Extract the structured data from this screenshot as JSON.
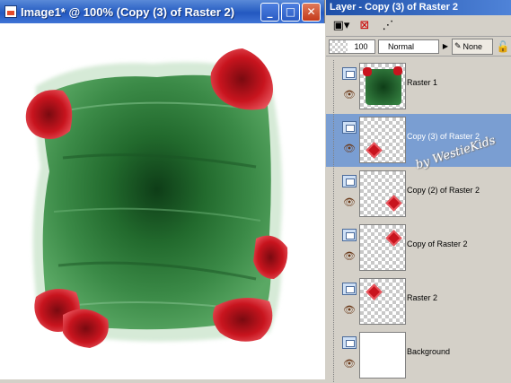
{
  "image_window": {
    "title": "Image1* @ 100% (Copy (3) of Raster 2)",
    "buttons": {
      "minimize": "_",
      "maximize": "□",
      "close": "✕"
    }
  },
  "layers_palette": {
    "title": "Layer - Copy (3) of Raster 2",
    "opacity": "100",
    "blend_mode": "Normal",
    "link_value": "None",
    "layers": [
      {
        "name": "Raster 1",
        "selected": false
      },
      {
        "name": "Copy (3) of Raster 2",
        "selected": true
      },
      {
        "name": "Copy (2) of Raster 2",
        "selected": false
      },
      {
        "name": "Copy of Raster 2",
        "selected": false
      },
      {
        "name": "Raster 2",
        "selected": false
      },
      {
        "name": "Background",
        "selected": false
      }
    ],
    "watermark": "by WestieKids"
  },
  "colors": {
    "title_blue": "#2d63c5",
    "selection": "#7a9ed2",
    "frame_green": "#2f7a3a",
    "corner_red": "#c8141e"
  }
}
